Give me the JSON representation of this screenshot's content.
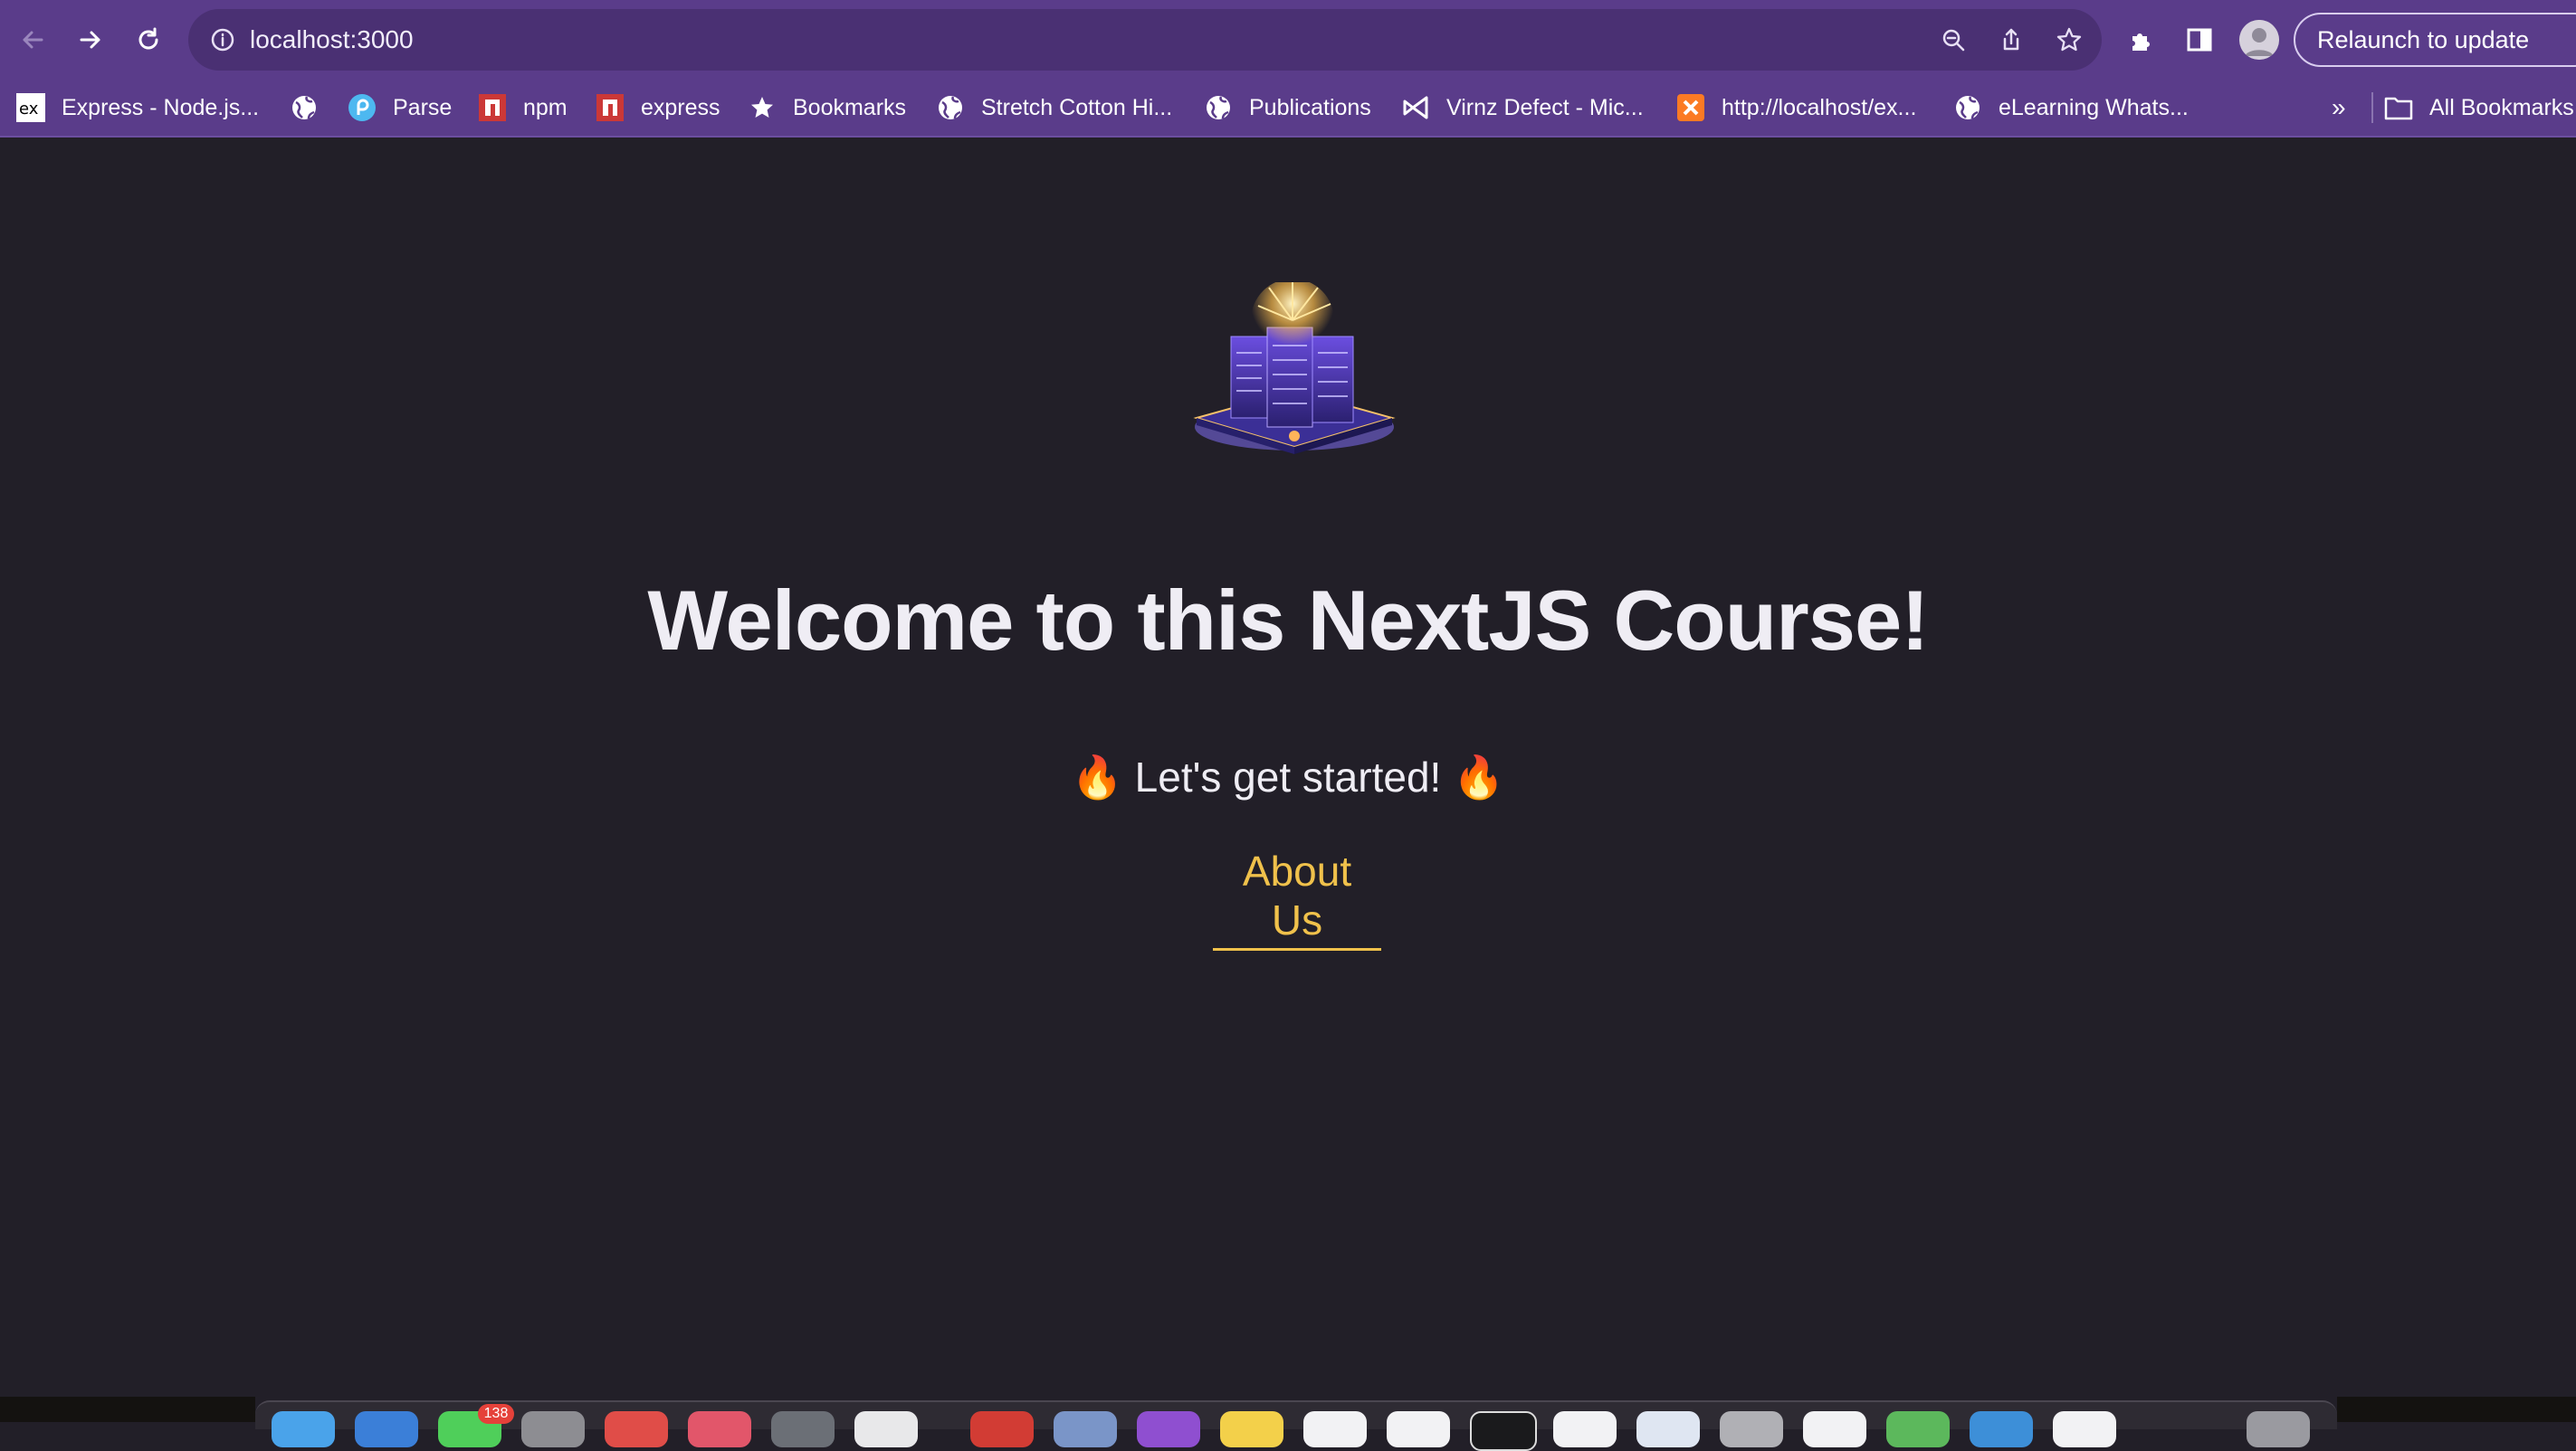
{
  "browser": {
    "url": "localhost:3000",
    "relaunch_label": "Relaunch to update",
    "bookmarks": [
      {
        "label": "Express - Node.js...",
        "icon": "express-icon"
      },
      {
        "label": "",
        "icon": "globe-icon"
      },
      {
        "label": "Parse",
        "icon": "parse-icon"
      },
      {
        "label": "npm",
        "icon": "npm-icon"
      },
      {
        "label": "express",
        "icon": "npm-icon"
      },
      {
        "label": "Bookmarks",
        "icon": "star-icon"
      },
      {
        "label": "Stretch Cotton Hi...",
        "icon": "globe-icon"
      },
      {
        "label": "Publications",
        "icon": "globe-icon"
      },
      {
        "label": "Virnz Defect - Mic...",
        "icon": "visual-studio-icon"
      },
      {
        "label": "http://localhost/ex...",
        "icon": "xampp-icon"
      },
      {
        "label": "eLearning Whats...",
        "icon": "globe-icon"
      }
    ],
    "overflow_label": "»",
    "all_bookmarks_label": "All Bookmarks"
  },
  "page": {
    "headline": "Welcome to this NextJS Course!",
    "subtitle": "🔥 Let's get started! 🔥",
    "about_link": "About Us"
  },
  "dock": {
    "badge_count": "138"
  },
  "colors": {
    "toolbar": "#5a3c8a",
    "page_background": "#221f28",
    "headline": "#efedf4",
    "link": "#f0c14b"
  }
}
